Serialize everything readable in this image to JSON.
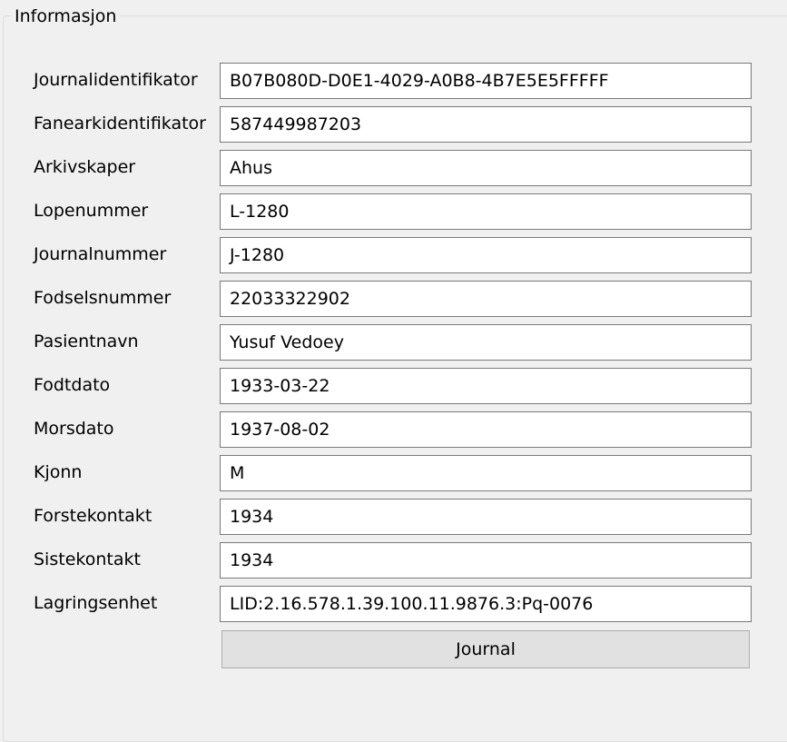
{
  "group": {
    "title": "Informasjon"
  },
  "fields": [
    {
      "label": "Journalidentifikator",
      "value": "B07B080D-D0E1-4029-A0B8-4B7E5E5FFFFF"
    },
    {
      "label": "Fanearkidentifikator",
      "value": "587449987203"
    },
    {
      "label": "Arkivskaper",
      "value": "Ahus"
    },
    {
      "label": "Lopenummer",
      "value": "L-1280"
    },
    {
      "label": "Journalnummer",
      "value": "J-1280"
    },
    {
      "label": "Fodselsnummer",
      "value": "22033322902"
    },
    {
      "label": "Pasientnavn",
      "value": "Yusuf Vedoey"
    },
    {
      "label": "Fodtdato",
      "value": "1933-03-22"
    },
    {
      "label": "Morsdato",
      "value": "1937-08-02"
    },
    {
      "label": "Kjonn",
      "value": "M"
    },
    {
      "label": "Forstekontakt",
      "value": "1934"
    },
    {
      "label": "Sistekontakt",
      "value": "1934"
    },
    {
      "label": "Lagringsenhet",
      "value": "LID:2.16.578.1.39.100.11.9876.3:Pq-0076"
    }
  ],
  "button": {
    "label": "Journal"
  }
}
